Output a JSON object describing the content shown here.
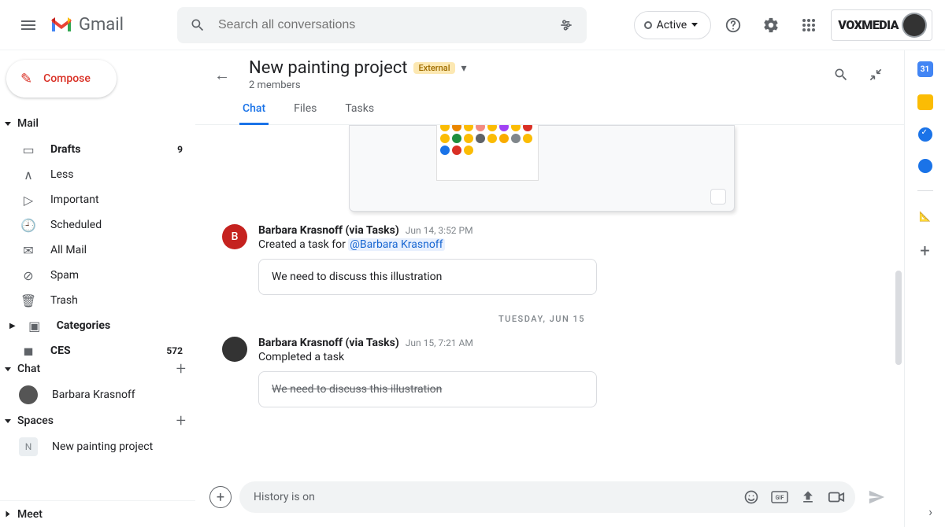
{
  "header": {
    "product": "Gmail",
    "search_placeholder": "Search all conversations",
    "status": "Active",
    "org": "VOXMEDIA"
  },
  "sidebar": {
    "compose": "Compose",
    "mail_label": "Mail",
    "items": [
      {
        "icon": "drafts",
        "label": "Drafts",
        "count": "9",
        "bold": true
      },
      {
        "icon": "less",
        "label": "Less"
      },
      {
        "icon": "important",
        "label": "Important"
      },
      {
        "icon": "scheduled",
        "label": "Scheduled"
      },
      {
        "icon": "allmail",
        "label": "All Mail"
      },
      {
        "icon": "spam",
        "label": "Spam"
      },
      {
        "icon": "trash",
        "label": "Trash"
      },
      {
        "icon": "categories",
        "label": "Categories",
        "bold": true,
        "expandable": true
      },
      {
        "icon": "label",
        "label": "CES",
        "count": "572",
        "bold": true
      }
    ],
    "chat_label": "Chat",
    "chat_items": [
      {
        "label": "Barbara Krasnoff"
      }
    ],
    "spaces_label": "Spaces",
    "space_items": [
      {
        "initial": "N",
        "label": "New painting project"
      }
    ],
    "meet_label": "Meet"
  },
  "space": {
    "title": "New painting project",
    "badge": "External",
    "subtitle": "2 members",
    "tabs": [
      "Chat",
      "Files",
      "Tasks"
    ],
    "active_tab": 0
  },
  "messages": [
    {
      "avatar_color": "#c5221f",
      "avatar_text": "B",
      "name": "Barbara Krasnoff (via Tasks)",
      "time": "Jun 14, 3:52 PM",
      "text_prefix": "Created a task for ",
      "mention": "@Barbara Krasnoff",
      "task": "We need to discuss this illustration",
      "done": false
    },
    {
      "divider": "TUESDAY, JUN 15"
    },
    {
      "avatar_img": true,
      "name": "Barbara Krasnoff (via Tasks)",
      "time": "Jun 15, 7:21 AM",
      "text_prefix": "Completed a task",
      "task": "We need to discuss this illustration",
      "done": true
    }
  ],
  "composer": {
    "placeholder": "History is on"
  },
  "rightrail": {
    "cal": "31"
  }
}
